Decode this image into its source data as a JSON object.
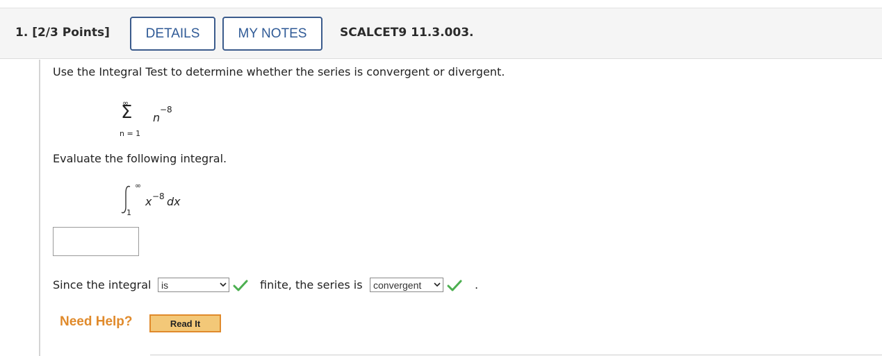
{
  "header": {
    "question_number": "1. [2/3 Points]",
    "details_label": "DETAILS",
    "notes_label": "MY NOTES",
    "problem_code": "SCALCET9 11.3.003."
  },
  "problem": {
    "instruction": "Use the Integral Test to determine whether the series is convergent or divergent.",
    "series": {
      "upper": "∞",
      "sigma": "Σ",
      "term_base": "n",
      "term_exp": "−8",
      "lower": "n = 1"
    },
    "evaluate_text": "Evaluate the following integral.",
    "integral": {
      "upper": "∞",
      "lower": "1",
      "integrand_base": "x",
      "integrand_exp": "−8",
      "differential": "dx"
    },
    "answer_value": "",
    "since_text": "Since the integral",
    "select1_value": "is",
    "finite_text": "finite, the series is",
    "select2_value": "convergent",
    "period": "."
  },
  "help": {
    "need_help": "Need Help?",
    "read_it": "Read It"
  },
  "colors": {
    "link_blue": "#2f5a96",
    "help_orange": "#e08a2b",
    "check_green": "#4caf50"
  }
}
